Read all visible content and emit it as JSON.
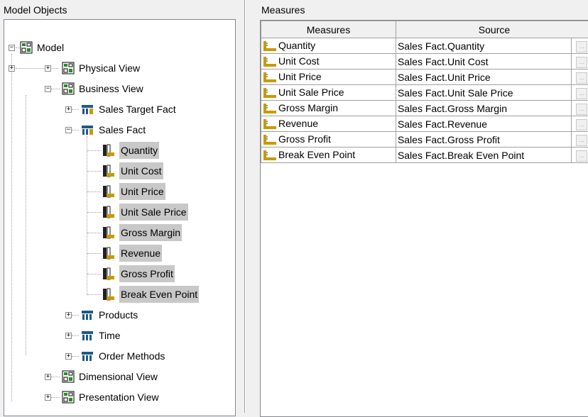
{
  "left_panel": {
    "title": "Model Objects"
  },
  "right_panel": {
    "title": "Measures"
  },
  "tree": {
    "nodes": [
      {
        "label": "Model",
        "expander": "−"
      },
      {
        "label": "Physical View",
        "expander": "+"
      },
      {
        "label": "Business View",
        "expander": "−"
      },
      {
        "label": "Sales Target Fact",
        "expander": "+"
      },
      {
        "label": "Sales Fact",
        "expander": "−"
      },
      {
        "label": "Quantity"
      },
      {
        "label": "Unit Cost"
      },
      {
        "label": "Unit Price"
      },
      {
        "label": "Unit Sale Price"
      },
      {
        "label": "Gross Margin"
      },
      {
        "label": "Revenue"
      },
      {
        "label": "Gross Profit"
      },
      {
        "label": "Break Even Point"
      },
      {
        "label": "Products",
        "expander": "+"
      },
      {
        "label": "Time",
        "expander": "+"
      },
      {
        "label": "Order Methods",
        "expander": "+"
      },
      {
        "label": "Dimensional View",
        "expander": "+"
      },
      {
        "label": "Presentation View",
        "expander": "+"
      }
    ]
  },
  "grid": {
    "columns": [
      "Measures",
      "Source"
    ],
    "rows": [
      {
        "measure": "Quantity",
        "source": "Sales Fact.Quantity",
        "button": "..."
      },
      {
        "measure": "Unit Cost",
        "source": "Sales Fact.Unit Cost",
        "button": "..."
      },
      {
        "measure": "Unit Price",
        "source": "Sales Fact.Unit Price",
        "button": "..."
      },
      {
        "measure": "Unit Sale Price",
        "source": "Sales Fact.Unit Sale Price",
        "button": "..."
      },
      {
        "measure": "Gross Margin",
        "source": "Sales Fact.Gross Margin",
        "button": "..."
      },
      {
        "measure": "Revenue",
        "source": "Sales Fact.Revenue",
        "button": "..."
      },
      {
        "measure": "Gross Profit",
        "source": "Sales Fact.Gross Profit",
        "button": "..."
      },
      {
        "measure": "Break Even Point",
        "source": "Sales Fact.Break Even Point",
        "button": "..."
      }
    ]
  },
  "colors": {
    "selection": "#c8c8c8",
    "header_bg": "#f0f0f0",
    "icon_gold": "#c89a00"
  }
}
